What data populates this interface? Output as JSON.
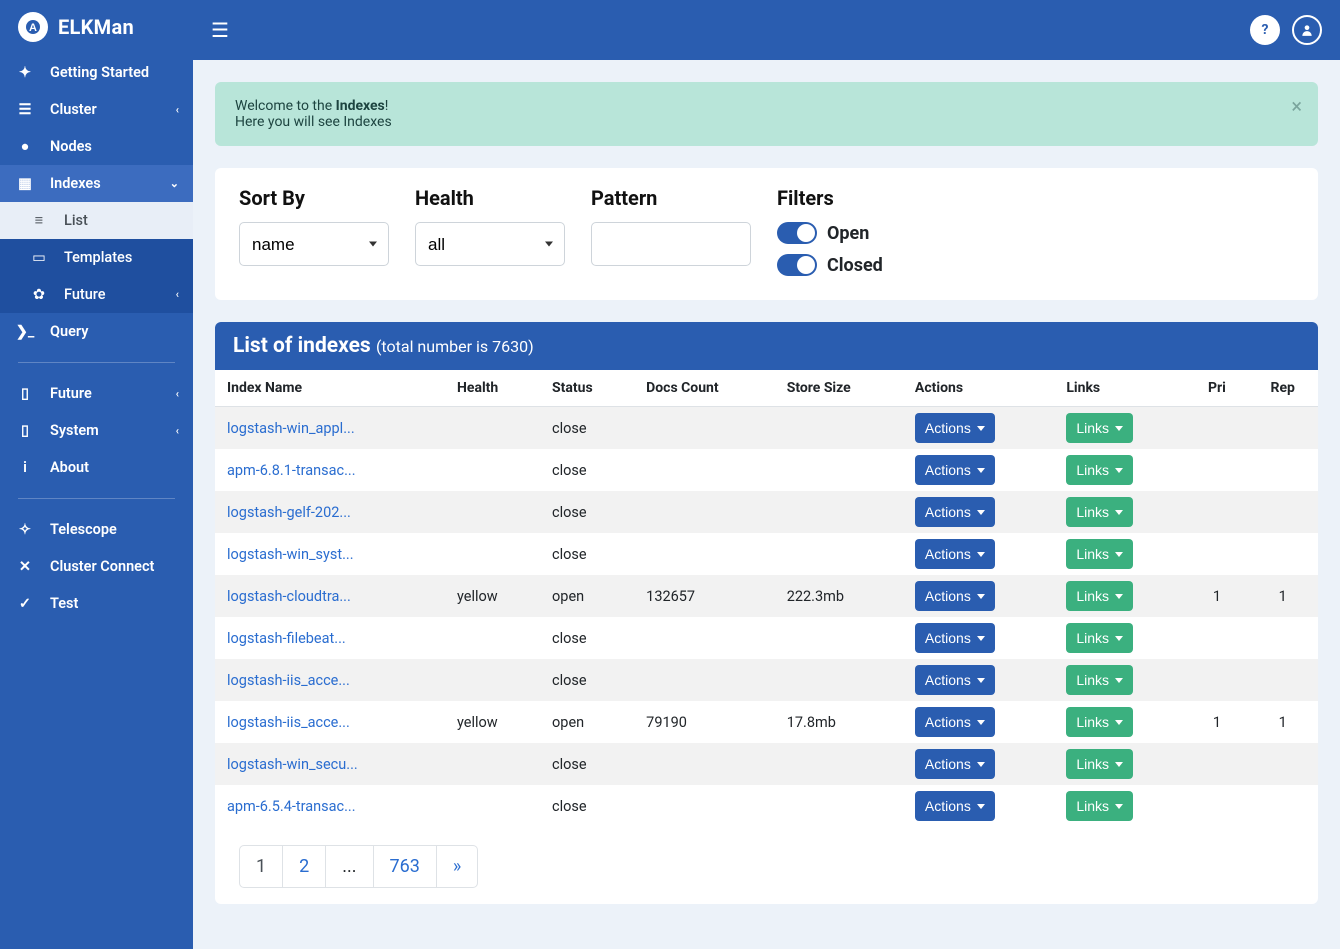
{
  "brand": "ELKMan",
  "sidebar": {
    "items": [
      {
        "label": "Getting Started",
        "icon": "rocket"
      },
      {
        "label": "Cluster",
        "icon": "server",
        "chev": "left"
      },
      {
        "label": "Nodes",
        "icon": "dot"
      },
      {
        "label": "Indexes",
        "icon": "grid",
        "chev": "down",
        "active": true
      },
      {
        "label": "List",
        "icon": "list",
        "sub": true,
        "subactive": true
      },
      {
        "label": "Templates",
        "icon": "square",
        "sub": true
      },
      {
        "label": "Future",
        "icon": "gear",
        "sub": true,
        "chev": "left"
      },
      {
        "label": "Query",
        "icon": "terminal"
      }
    ],
    "group2": [
      {
        "label": "Future",
        "icon": "file",
        "chev": "left"
      },
      {
        "label": "System",
        "icon": "file",
        "chev": "left"
      },
      {
        "label": "About",
        "icon": "info"
      }
    ],
    "group3": [
      {
        "label": "Telescope",
        "icon": "target"
      },
      {
        "label": "Cluster Connect",
        "icon": "compress"
      },
      {
        "label": "Test",
        "icon": "check"
      }
    ]
  },
  "alert": {
    "line1_a": "Welcome to the ",
    "line1_b": "Indexes",
    "line1_c": "!",
    "line2": "Here you will see Indexes"
  },
  "filters": {
    "sort_label": "Sort By",
    "sort_value": "name",
    "health_label": "Health",
    "health_value": "all",
    "pattern_label": "Pattern",
    "pattern_value": "",
    "filters_label": "Filters",
    "open_label": "Open",
    "closed_label": "Closed"
  },
  "panel": {
    "title": "List of indexes ",
    "subtitle": "(total number is 7630)"
  },
  "columns": {
    "c0": "Index Name",
    "c1": "Health",
    "c2": "Status",
    "c3": "Docs Count",
    "c4": "Store Size",
    "c5": "Actions",
    "c6": "Links",
    "c7": "Pri",
    "c8": "Rep"
  },
  "buttons": {
    "actions": "Actions",
    "links": "Links"
  },
  "rows": [
    {
      "name": "logstash-win_appl...",
      "health": "",
      "status": "close",
      "docs": "",
      "size": "",
      "pri": "",
      "rep": ""
    },
    {
      "name": "apm-6.8.1-transac...",
      "health": "",
      "status": "close",
      "docs": "",
      "size": "",
      "pri": "",
      "rep": ""
    },
    {
      "name": "logstash-gelf-202...",
      "health": "",
      "status": "close",
      "docs": "",
      "size": "",
      "pri": "",
      "rep": ""
    },
    {
      "name": "logstash-win_syst...",
      "health": "",
      "status": "close",
      "docs": "",
      "size": "",
      "pri": "",
      "rep": ""
    },
    {
      "name": "logstash-cloudtra...",
      "health": "yellow",
      "status": "open",
      "docs": "132657",
      "size": "222.3mb",
      "pri": "1",
      "rep": "1"
    },
    {
      "name": "logstash-filebeat...",
      "health": "",
      "status": "close",
      "docs": "",
      "size": "",
      "pri": "",
      "rep": ""
    },
    {
      "name": "logstash-iis_acce...",
      "health": "",
      "status": "close",
      "docs": "",
      "size": "",
      "pri": "",
      "rep": ""
    },
    {
      "name": "logstash-iis_acce...",
      "health": "yellow",
      "status": "open",
      "docs": "79190",
      "size": "17.8mb",
      "pri": "1",
      "rep": "1"
    },
    {
      "name": "logstash-win_secu...",
      "health": "",
      "status": "close",
      "docs": "",
      "size": "",
      "pri": "",
      "rep": ""
    },
    {
      "name": "apm-6.5.4-transac...",
      "health": "",
      "status": "close",
      "docs": "",
      "size": "",
      "pri": "",
      "rep": ""
    }
  ],
  "pagination": {
    "p0": "1",
    "p1": "2",
    "p2": "...",
    "p3": "763",
    "p4": "»"
  }
}
